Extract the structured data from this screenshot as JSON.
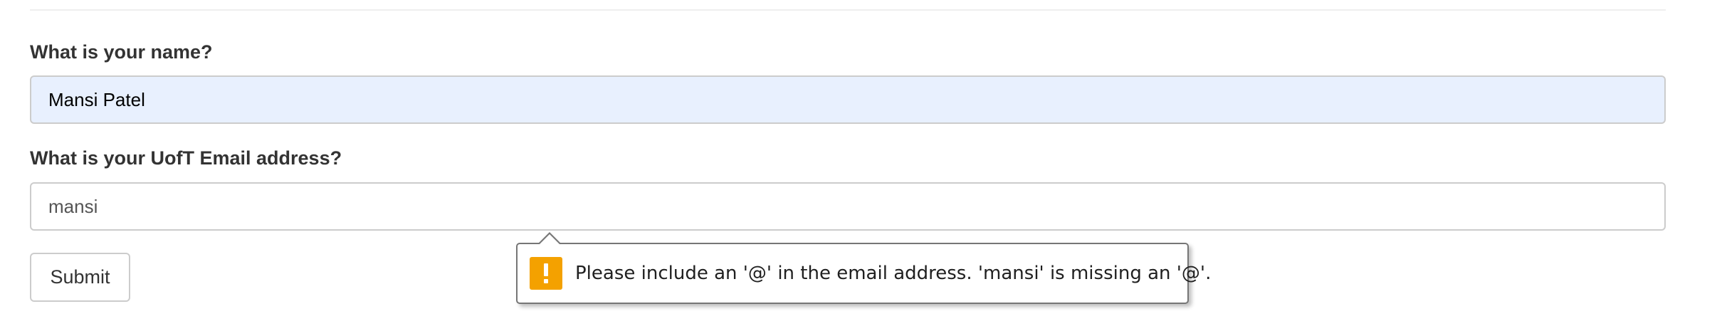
{
  "form": {
    "name_label": "What is your name?",
    "name_value": "Mansi Patel",
    "email_label": "What is your UofT Email address?",
    "email_value": "mansi",
    "submit_label": "Submit"
  },
  "validation_tooltip": {
    "icon": "warning-icon",
    "icon_color": "#f4a100",
    "message": "Please include an '@' in the email address. 'mansi' is missing an '@'."
  },
  "colors": {
    "autofill_background": "#e8f0fe",
    "input_border": "#cccccc",
    "label_text": "#333333"
  }
}
